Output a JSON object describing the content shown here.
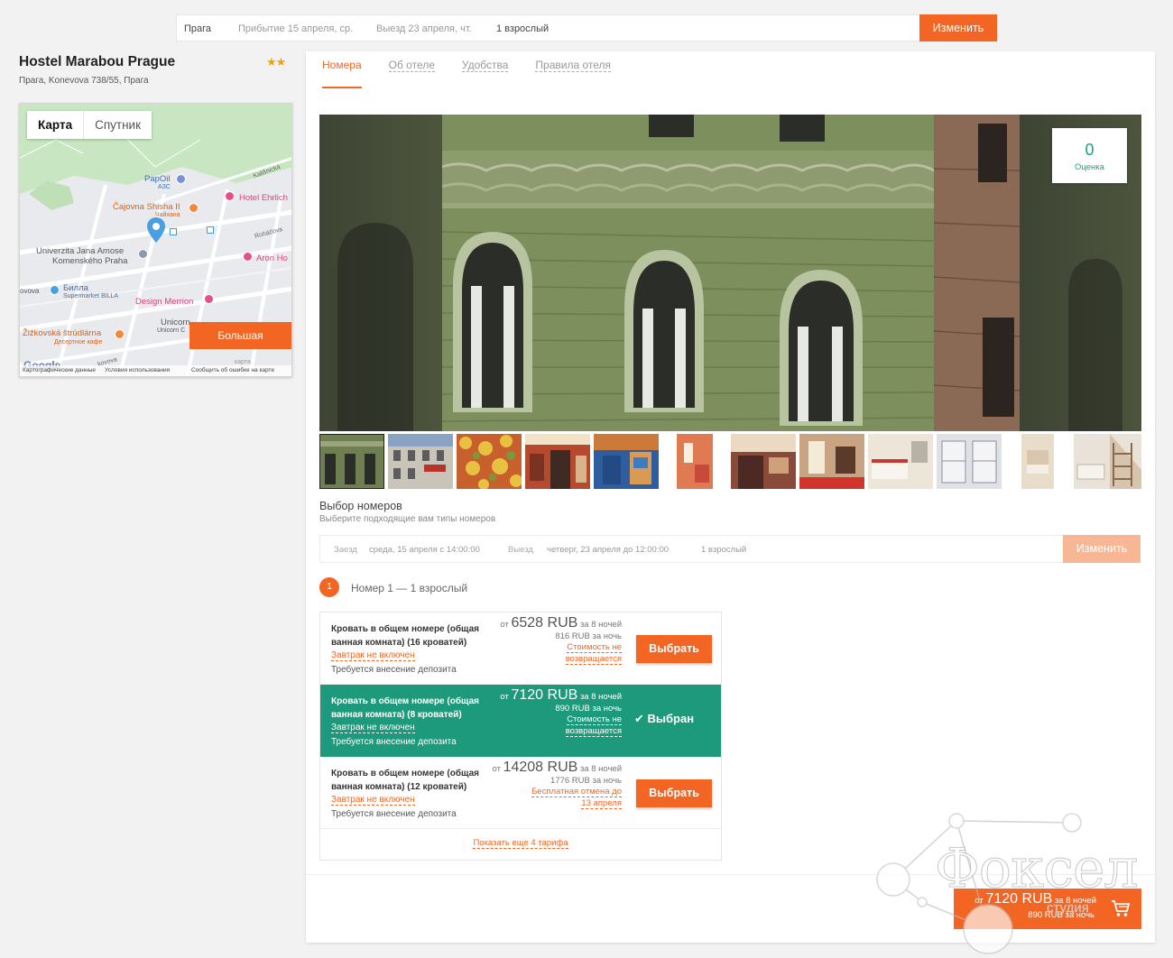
{
  "search": {
    "city": "Прага",
    "arrival": "Прибытие 15 апреля, ср.",
    "departure": "Выезд 23 апреля, чт.",
    "guests": "1 взрослый",
    "change": "Изменить"
  },
  "hotel": {
    "name": "Hostel Marabou Prague",
    "stars": "★★",
    "address": "Прага, Konevova 738/55, Прага"
  },
  "map": {
    "tab_map": "Карта",
    "tab_satellite": "Спутник",
    "bigger": "Большая",
    "footer_data": "Картографические данные",
    "footer_terms": "Условия использования",
    "footer_report": "Сообщить об ошибке на карте",
    "google": "Google",
    "labels": {
      "papoil": "PapOil",
      "azs": "АЗС",
      "cajovna": "Čajovna Shisha II",
      "chaihana": "Чайхана",
      "ehrlich": "Hotel Ehrlich",
      "kalisnicka": "Kališnická",
      "univerzita1": "Univerzita Jana Amose",
      "univerzita2": "Komenského Praha",
      "rohacova": "Roháčova",
      "aron": "Aron Ho",
      "vova": "ovova",
      "billa": "Билла",
      "billa_sub": "Supermarket BILLA",
      "design": "Design Merrion",
      "unicorn": "Unicorn",
      "unicorn_sub": "Unicorn C",
      "zizkovska": "Žižkovská štrúdlárna",
      "zizkovska_sub": "Десертное кафе",
      "kovova": "kovova",
      "karta": "карта"
    }
  },
  "tabs": [
    "Номера",
    "Об отеле",
    "Удобства",
    "Правила отеля"
  ],
  "rating": {
    "value": "0",
    "label": "Оценка"
  },
  "selection": {
    "title": "Выбор номеров",
    "subtitle": "Выберите подходящие вам типы номеров",
    "checkin_label": "Заезд",
    "checkin_value": "среда, 15 апреля с 14:00:00",
    "checkout_label": "Выезд",
    "checkout_value": "четверг, 23 апреля до 12:00:00",
    "guests": "1 взрослый",
    "change": "Изменить"
  },
  "room": {
    "number": "1",
    "label": "Номер 1 — 1 взрослый"
  },
  "rates": [
    {
      "name": "Кровать в общем номере (общая ванная комната) (16 кроватей)",
      "breakfast": "Завтрак не включен",
      "deposit": "Требуется внесение депозита",
      "from": "от",
      "price": "6528 RUB",
      "nights": "за 8 ночей",
      "per_night": "816 RUB за ночь",
      "cancel1": "Стоимость не",
      "cancel2": "возвращается",
      "action": "Выбрать"
    },
    {
      "name": "Кровать в общем номере (общая ванная комната) (8 кроватей)",
      "breakfast": "Завтрак не включен",
      "deposit": "Требуется внесение депозита",
      "from": "от",
      "price": "7120 RUB",
      "nights": "за 8 ночей",
      "per_night": "890 RUB за ночь",
      "cancel1": "Стоимость не",
      "cancel2": "возвращается",
      "action": "✔ Выбран"
    },
    {
      "name": "Кровать в общем номере (общая ванная комната) (12 кроватей)",
      "breakfast": "Завтрак не включен",
      "deposit": "Требуется внесение депозита",
      "from": "от",
      "price": "14208 RUB",
      "nights": "за 8 ночей",
      "per_night": "1776 RUB за ночь",
      "cancel1": "Бесплатная отмена до",
      "cancel2": "13 апреля",
      "action": "Выбрать"
    }
  ],
  "more_rates": "Показать еще 4 тарифа",
  "cart": {
    "from": "от",
    "price": "7120 RUB",
    "nights": "за 8 ночей",
    "per_night": "890 RUB за ночь",
    "icon": "cart-icon"
  },
  "watermark": {
    "text": "Фоксел",
    "sub": "студия"
  },
  "colors": {
    "accent": "#f26522",
    "selected": "#1d9a7b",
    "rating": "#1ca081"
  }
}
